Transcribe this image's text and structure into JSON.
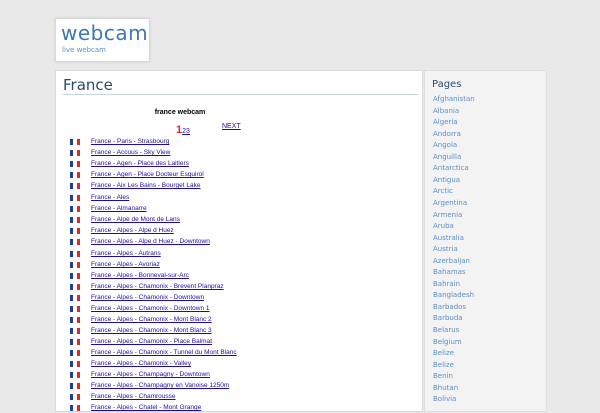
{
  "site": {
    "title": "webcam",
    "subtitle": "live webcam"
  },
  "main": {
    "title": "France",
    "list_heading": "france webcam",
    "pagination": {
      "current": "1",
      "pages": [
        "2",
        "3"
      ],
      "next": "NEXT"
    },
    "webcams": [
      "France - Paris - Strasbourg",
      "France - Accous - Sky View",
      "France - Agen - Place des Laitiers",
      "France - Agen - Place Docteur Esquirol",
      "France - Aix Les Bains - Bourget Lake",
      "France - Ales",
      "France - Almanarre",
      "France - Alpe de Mont de Lans",
      "France - Alpes - Alpe d Huez",
      "France - Alpes - Alpe d Huez - Downtown",
      "France - Alpes - Autrans",
      "France - Alpes - Avoriaz",
      "France - Alpes - Bonneval-sur-Arc",
      "France - Alpes - Chamonix - Brevent Planpraz",
      "France - Alpes - Chamonix - Downtown",
      "France - Alpes - Chamonix - Downtown 1",
      "France - Alpes - Chamonix - Mont Blanc 2",
      "France - Alpes - Chamonix - Mont Blanc 3",
      "France - Alpes - Chamonix - Place Balmat",
      "France - Alpes - Chamonix - Tunnel du Mont Blanc",
      "France - Alpes - Chamonix - Valley",
      "France - Alpes - Champagny - Downtown",
      "France - Alpes - Champagny en Vanoise 1250m",
      "France - Alpes - Chamrousse",
      "France - Alpes - Chatel - Mont Grange"
    ]
  },
  "sidebar": {
    "title": "Pages",
    "countries": [
      "Afghanistan",
      "Albania",
      "Algeria",
      "Andorra",
      "Angola",
      "Anguilla",
      "Antarctica",
      "Antigua",
      "Arctic",
      "Argentina",
      "Armenia",
      "Aruba",
      "Australia",
      "Austria",
      "Azerbaijan",
      "Bahamas",
      "Bahrain",
      "Bangladesh",
      "Barbados",
      "Barbuda",
      "Belarus",
      "Belgium",
      "Belize",
      "Belize",
      "Benin",
      "Bhutan",
      "Bolivia"
    ]
  }
}
